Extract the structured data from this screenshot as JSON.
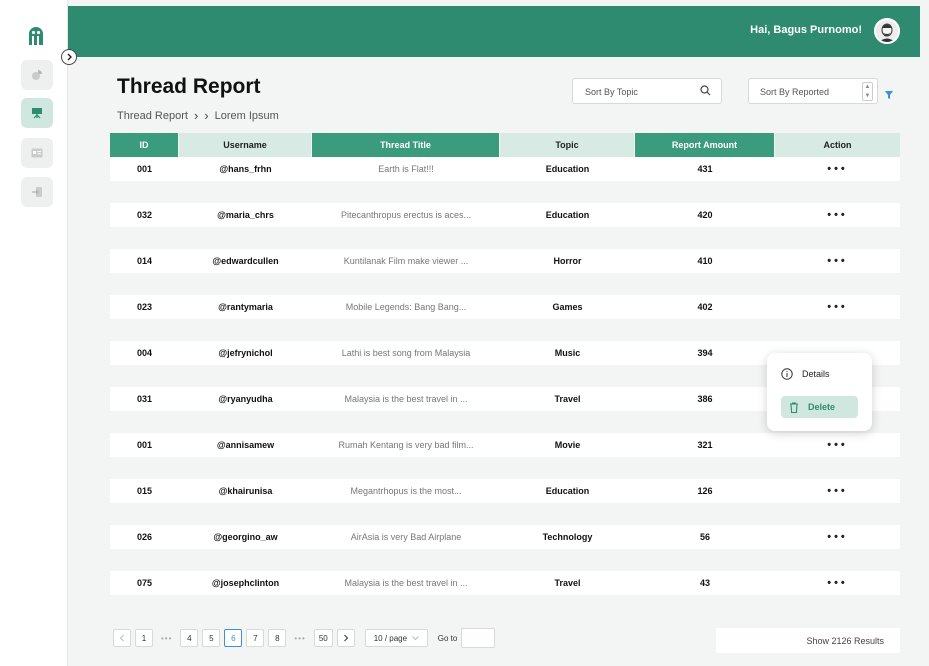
{
  "header": {
    "greeting": "Hai, Bagus Purnomo!"
  },
  "page": {
    "title": "Thread Report",
    "breadcrumb": [
      "Thread Report",
      "Lorem Ipsum"
    ]
  },
  "filters": {
    "sort_topic_placeholder": "Sort By Topic",
    "sort_reported_placeholder": "Sort By Reported"
  },
  "table": {
    "columns": [
      "ID",
      "Username",
      "Thread Title",
      "Topic",
      "Report Amount",
      "Action"
    ],
    "rows": [
      {
        "id": "001",
        "username": "@hans_frhn",
        "title": "Earth is Flat!!!",
        "topic": "Education",
        "amount": "431",
        "action": "•••"
      },
      {
        "id": "032",
        "username": "@maria_chrs",
        "title": "Pitecanthropus erectus is aces...",
        "topic": "Education",
        "amount": "420",
        "action": "•••"
      },
      {
        "id": "014",
        "username": "@edwardcullen",
        "title": "Kuntilanak Film make viewer ...",
        "topic": "Horror",
        "amount": "410",
        "action": "•••"
      },
      {
        "id": "023",
        "username": "@rantymaria",
        "title": "Mobile Legends: Bang Bang...",
        "topic": "Games",
        "amount": "402",
        "action": "•••"
      },
      {
        "id": "004",
        "username": "@jefrynichol",
        "title": "Lathi is best song from Malaysia",
        "topic": "Music",
        "amount": "394",
        "action": ""
      },
      {
        "id": "031",
        "username": "@ryanyudha",
        "title": "Malaysia is the best travel in ...",
        "topic": "Travel",
        "amount": "386",
        "action": ""
      },
      {
        "id": "001",
        "username": "@annisamew",
        "title": "Rumah Kentang is very bad film...",
        "topic": "Movie",
        "amount": "321",
        "action": "•••"
      },
      {
        "id": "015",
        "username": "@khairunisa",
        "title": "Megantrhopus is the most...",
        "topic": "Education",
        "amount": "126",
        "action": "•••"
      },
      {
        "id": "026",
        "username": "@georgino_aw",
        "title": "AirAsia is very Bad Airplane",
        "topic": "Technology",
        "amount": "56",
        "action": "•••"
      },
      {
        "id": "075",
        "username": "@josephclinton",
        "title": "Malaysia is the best travel in ...",
        "topic": "Travel",
        "amount": "43",
        "action": "•••"
      }
    ]
  },
  "action_menu": {
    "details": "Details",
    "delete": "Delete"
  },
  "pagination": {
    "pages": [
      "1",
      "4",
      "5",
      "6",
      "7",
      "8",
      "50"
    ],
    "ellipsis": "•••",
    "current": "6",
    "per_page": "10 / page",
    "goto_label": "Go to",
    "results": "Show 2126 Results"
  },
  "colors": {
    "brand": "#2e8b6f",
    "header_light": "#d7eae4",
    "header_dark": "#3a9b7d",
    "accent_blue": "#3b8fe0"
  }
}
